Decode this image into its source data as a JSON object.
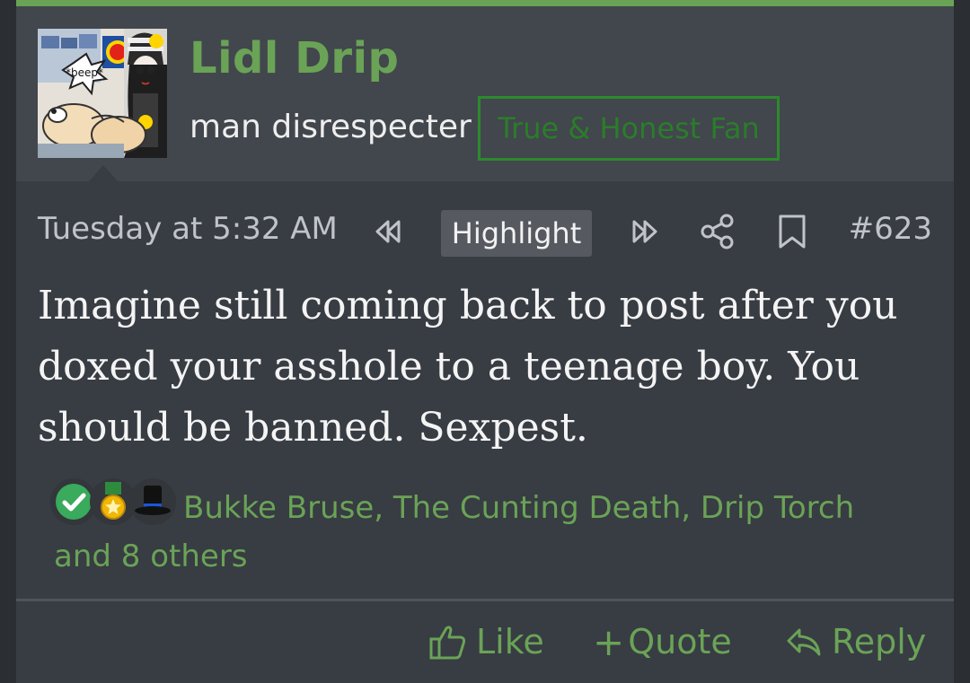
{
  "user": {
    "name": "Lidl Drip",
    "title": "man disrespecter",
    "banner": "True & Honest Fan",
    "avatar_caption": "*beep*"
  },
  "post": {
    "timestamp": "Tuesday at 5:32 AM",
    "highlight_label": "Highlight",
    "number": "#623",
    "body": "Imagine still coming back to post after you doxed your asshole to a teenage boy. You should be banned. Sexpest."
  },
  "reactions": {
    "icons": [
      "check-icon",
      "medal-icon",
      "top-hat-icon"
    ],
    "summary": "Bukke Bruse, The Cunting Death, Drip Torch and 8 others"
  },
  "actions": {
    "like": "Like",
    "quote": "Quote",
    "reply": "Reply"
  },
  "colors": {
    "accent": "#6aa356",
    "banner_border": "#2c8a2c",
    "header_bg": "#42464d",
    "post_bg": "#383c43",
    "text": "#f4f4f4",
    "muted": "#c0c3c8"
  }
}
